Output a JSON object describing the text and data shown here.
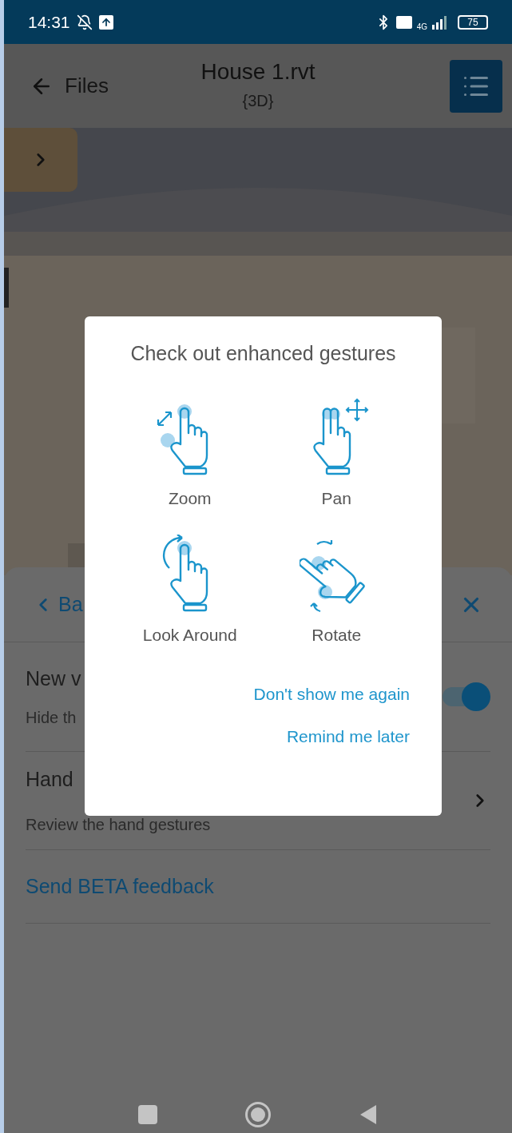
{
  "status_bar": {
    "time": "14:31",
    "network": "4G",
    "battery": "75"
  },
  "header": {
    "back_label": "Files",
    "title": "House 1.rvt",
    "subtitle": "{3D}"
  },
  "sheet": {
    "back_label": "Ba",
    "rows": [
      {
        "kind": "toggle",
        "title": "New v",
        "subtitle": "Hide th",
        "on": true
      },
      {
        "kind": "link",
        "title": "Hand",
        "subtitle": "Review the hand gestures"
      },
      {
        "kind": "action",
        "title": "Send BETA feedback"
      }
    ]
  },
  "dialog": {
    "title": "Check out enhanced gestures",
    "gestures": [
      {
        "kind": "zoom",
        "label": "Zoom"
      },
      {
        "kind": "pan",
        "label": "Pan"
      },
      {
        "kind": "look_around",
        "label": "Look Around"
      },
      {
        "kind": "rotate",
        "label": "Rotate"
      }
    ],
    "actions": [
      "Don't show me again",
      "Remind me later"
    ]
  }
}
